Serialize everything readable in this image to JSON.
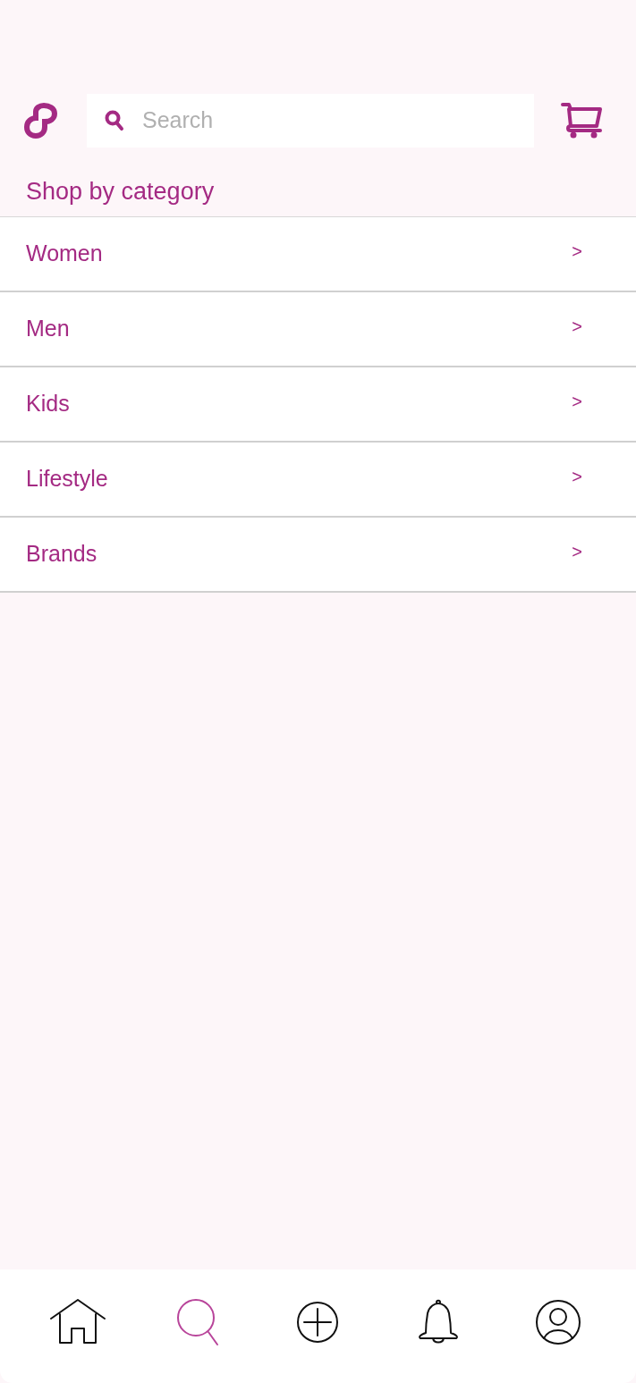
{
  "search": {
    "placeholder": "Search"
  },
  "section_title": "Shop by category",
  "categories": [
    {
      "label": "Women",
      "chevron": ">"
    },
    {
      "label": "Men",
      "chevron": ">"
    },
    {
      "label": "Kids",
      "chevron": ">"
    },
    {
      "label": "Lifestyle",
      "chevron": ">"
    },
    {
      "label": "Brands",
      "chevron": ">"
    }
  ],
  "bottom_nav": [
    {
      "kind": "home",
      "selected": false
    },
    {
      "kind": "search",
      "selected": true
    },
    {
      "kind": "add",
      "selected": false
    },
    {
      "kind": "notifications",
      "selected": false
    },
    {
      "kind": "profile",
      "selected": false
    }
  ]
}
